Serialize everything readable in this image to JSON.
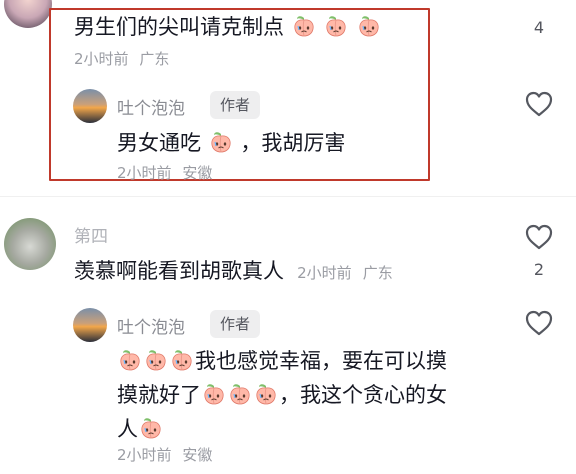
{
  "comments": [
    {
      "text": "男生们的尖叫请克制点",
      "emoji_count": 3,
      "time": "2小时前",
      "location": "广东",
      "like_count": "4",
      "reply": {
        "username": "吐个泡泡",
        "author_tag": "作者",
        "text_before": "男女通吃",
        "text_after": "，我胡厉害",
        "time": "2小时前",
        "location": "安徽"
      }
    },
    {
      "username": "第四",
      "text": "羡慕啊能看到胡歌真人",
      "time": "2小时前",
      "location": "广东",
      "like_count": "2",
      "reply": {
        "username": "吐个泡泡",
        "author_tag": "作者",
        "line1": "我也感觉幸福，要在可以摸",
        "line2a": "摸就好了",
        "line2b": "，我这个贪心的女",
        "line3": "人",
        "time": "2小时前",
        "location": "安徽"
      }
    }
  ],
  "colors": {
    "highlight_box": "#c0392b",
    "meta_gray": "#9a9ca3",
    "heart_stroke": "#555860"
  },
  "icons": [
    "heart-outline-icon",
    "peach-emoji-icon",
    "avatar"
  ]
}
